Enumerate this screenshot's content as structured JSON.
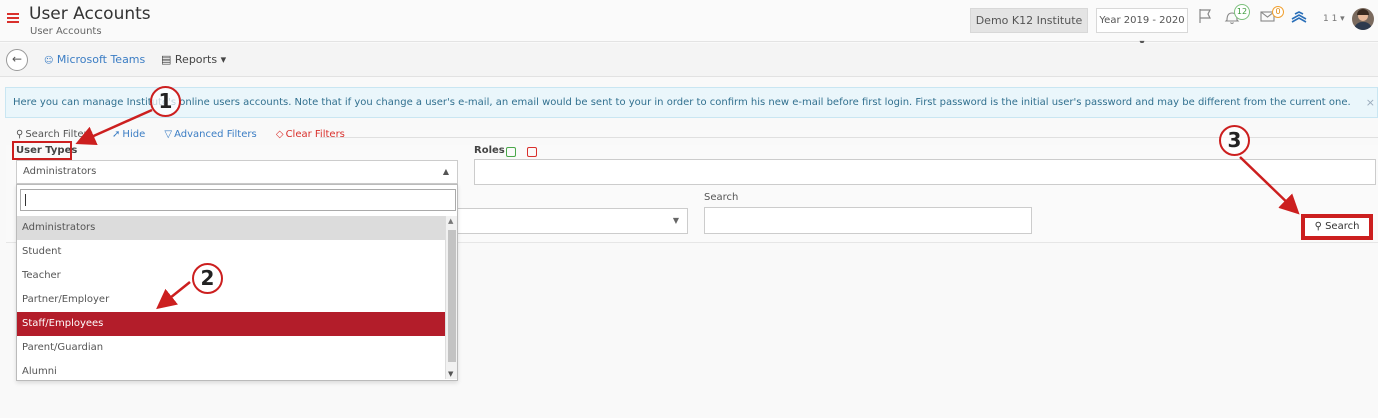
{
  "header": {
    "title": "User Accounts",
    "subtitle": "User Accounts",
    "institute": "Demo K12 Institute",
    "year": "Year 2019 - 2020 ▾",
    "notifications_count": "12",
    "messages_count": "0",
    "user_number": "1 1 ▾"
  },
  "toolbar": {
    "back_label": "←",
    "teams_label": "Microsoft Teams",
    "reports_label": "Reports ▾"
  },
  "info": {
    "text": "Here you can manage Institute's online users accounts. Note that if you change a user's e-mail, an email would be sent to your in order to confirm his new e-mail before first login. First password is the initial user's password and may be different from the current one.",
    "close": "×"
  },
  "filters": {
    "search_filters_label": "Search Filters",
    "hide_label": "Hide",
    "advanced_label": "Advanced Filters",
    "clear_label": "Clear Filters",
    "user_types_label": "User Types",
    "user_types_value": "Administrators",
    "roles_label": "Roles",
    "search_label": "Search",
    "search_button": "Search"
  },
  "dropdown": {
    "items": [
      "Administrators",
      "Student",
      "Teacher",
      "Partner/Employer",
      "Staff/Employees",
      "Parent/Guardian",
      "Alumni"
    ],
    "highlighted_index": 0,
    "selected_index": 4
  },
  "annotations": [
    "1",
    "2",
    "3"
  ],
  "colors": {
    "accent_red": "#cc1f1f",
    "selected_bg": "#b31d2a",
    "link_blue": "#3b7dc4",
    "info_bg": "#eaf6fb"
  }
}
